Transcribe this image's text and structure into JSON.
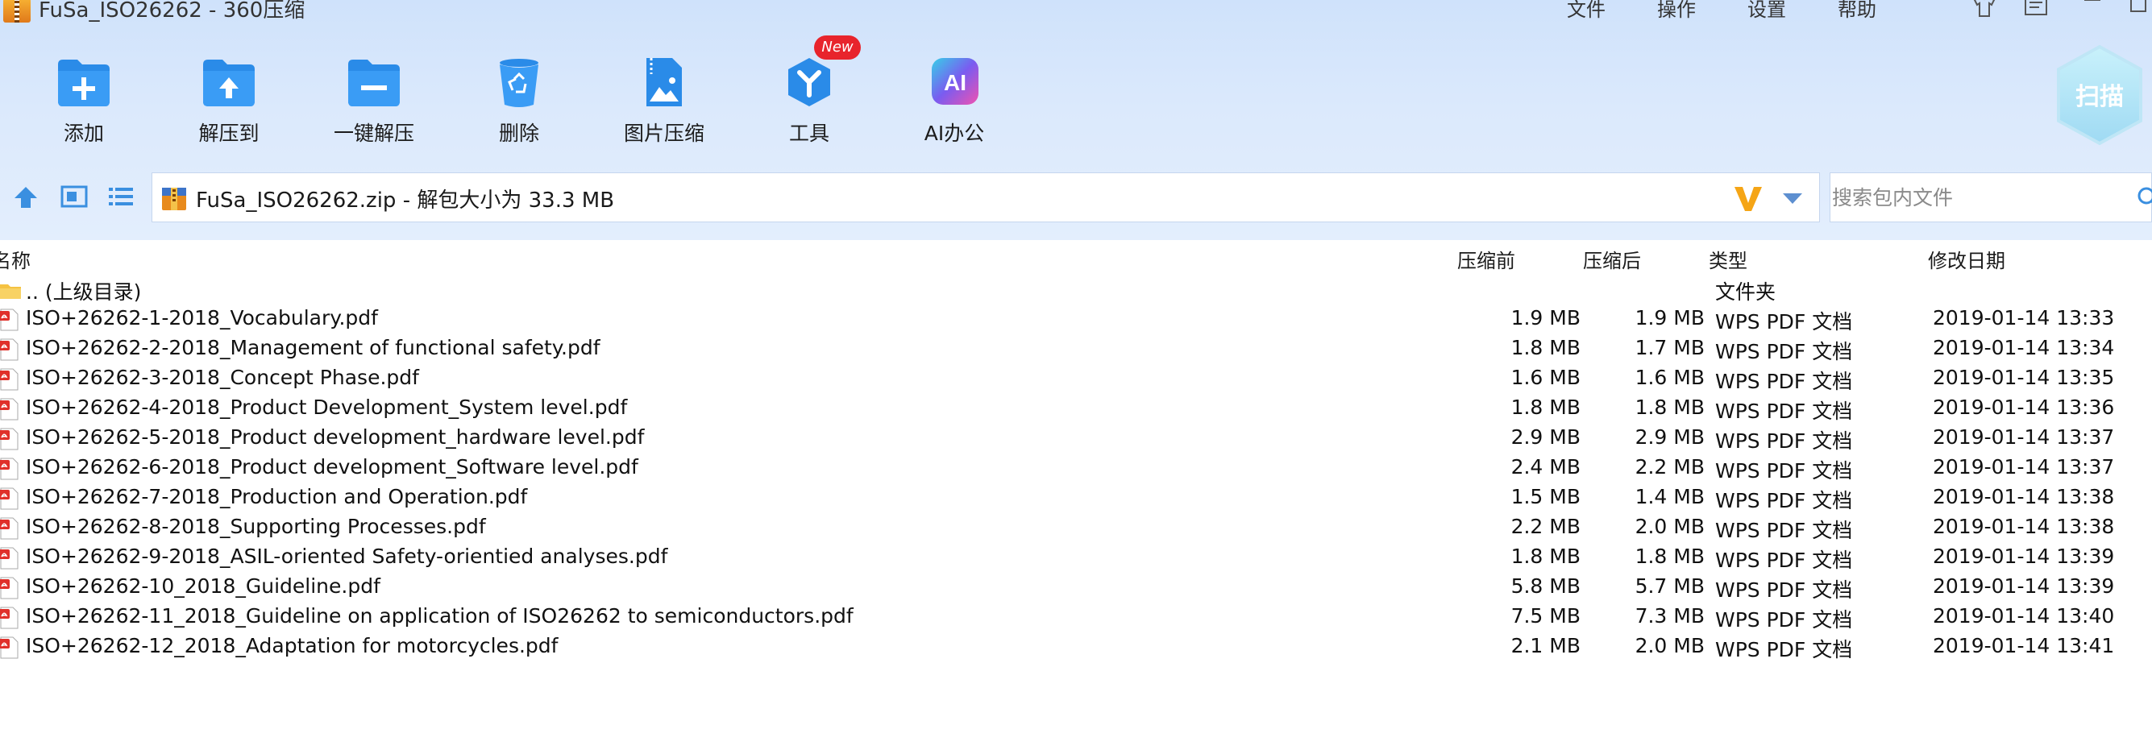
{
  "window": {
    "title": "FuSa_ISO26262 - 360压缩",
    "menu": [
      "文件",
      "操作",
      "设置",
      "帮助"
    ]
  },
  "toolbar": {
    "tools": [
      {
        "label": "添加",
        "icon": "add-file-icon"
      },
      {
        "label": "解压到",
        "icon": "extract-to-icon"
      },
      {
        "label": "一键解压",
        "icon": "one-click-extract-icon"
      },
      {
        "label": "删除",
        "icon": "recycle-bin-icon"
      },
      {
        "label": "图片压缩",
        "icon": "image-compress-icon"
      },
      {
        "label": "工具",
        "icon": "tools-icon"
      },
      {
        "label": "AI办公",
        "icon": "ai-office-icon"
      }
    ],
    "new_badge": "New",
    "scan_label": "扫描"
  },
  "address": {
    "text": "FuSa_ISO26262.zip - 解包大小为 33.3 MB"
  },
  "search": {
    "placeholder": "搜索包内文件"
  },
  "table": {
    "columns": [
      "名称",
      "压缩前",
      "压缩后",
      "类型",
      "修改日期"
    ],
    "parent_dir": {
      "name": ".. (上级目录)",
      "type": "文件夹"
    },
    "rows": [
      {
        "name": "ISO+26262-1-2018_Vocabulary.pdf",
        "size": "1.9 MB",
        "packed": "1.9 MB",
        "type": "WPS PDF 文档",
        "date": "2019-01-14 13:33"
      },
      {
        "name": "ISO+26262-2-2018_Management of functional safety.pdf",
        "size": "1.8 MB",
        "packed": "1.7 MB",
        "type": "WPS PDF 文档",
        "date": "2019-01-14 13:34"
      },
      {
        "name": "ISO+26262-3-2018_Concept Phase.pdf",
        "size": "1.6 MB",
        "packed": "1.6 MB",
        "type": "WPS PDF 文档",
        "date": "2019-01-14 13:35"
      },
      {
        "name": "ISO+26262-4-2018_Product Development_System level.pdf",
        "size": "1.8 MB",
        "packed": "1.8 MB",
        "type": "WPS PDF 文档",
        "date": "2019-01-14 13:36"
      },
      {
        "name": "ISO+26262-5-2018_Product development_hardware level.pdf",
        "size": "2.9 MB",
        "packed": "2.9 MB",
        "type": "WPS PDF 文档",
        "date": "2019-01-14 13:37"
      },
      {
        "name": "ISO+26262-6-2018_Product development_Software level.pdf",
        "size": "2.4 MB",
        "packed": "2.2 MB",
        "type": "WPS PDF 文档",
        "date": "2019-01-14 13:37"
      },
      {
        "name": "ISO+26262-7-2018_Production and Operation.pdf",
        "size": "1.5 MB",
        "packed": "1.4 MB",
        "type": "WPS PDF 文档",
        "date": "2019-01-14 13:38"
      },
      {
        "name": "ISO+26262-8-2018_Supporting Processes.pdf",
        "size": "2.2 MB",
        "packed": "2.0 MB",
        "type": "WPS PDF 文档",
        "date": "2019-01-14 13:38"
      },
      {
        "name": "ISO+26262-9-2018_ASIL-oriented Safety-orientied analyses.pdf",
        "size": "1.8 MB",
        "packed": "1.8 MB",
        "type": "WPS PDF 文档",
        "date": "2019-01-14 13:39"
      },
      {
        "name": "ISO+26262-10_2018_Guideline.pdf",
        "size": "5.8 MB",
        "packed": "5.7 MB",
        "type": "WPS PDF 文档",
        "date": "2019-01-14 13:39"
      },
      {
        "name": "ISO+26262-11_2018_Guideline on application of ISO26262 to semiconductors.pdf",
        "size": "7.5 MB",
        "packed": "7.3 MB",
        "type": "WPS PDF 文档",
        "date": "2019-01-14 13:40"
      },
      {
        "name": "ISO+26262-12_2018_Adaptation for motorcycles.pdf",
        "size": "2.1 MB",
        "packed": "2.0 MB",
        "type": "WPS PDF 文档",
        "date": "2019-01-14 13:41"
      }
    ]
  },
  "colors": {
    "accent": "#2a8be8",
    "pdf_red": "#e0302a",
    "folder_yellow": "#f5c242"
  }
}
